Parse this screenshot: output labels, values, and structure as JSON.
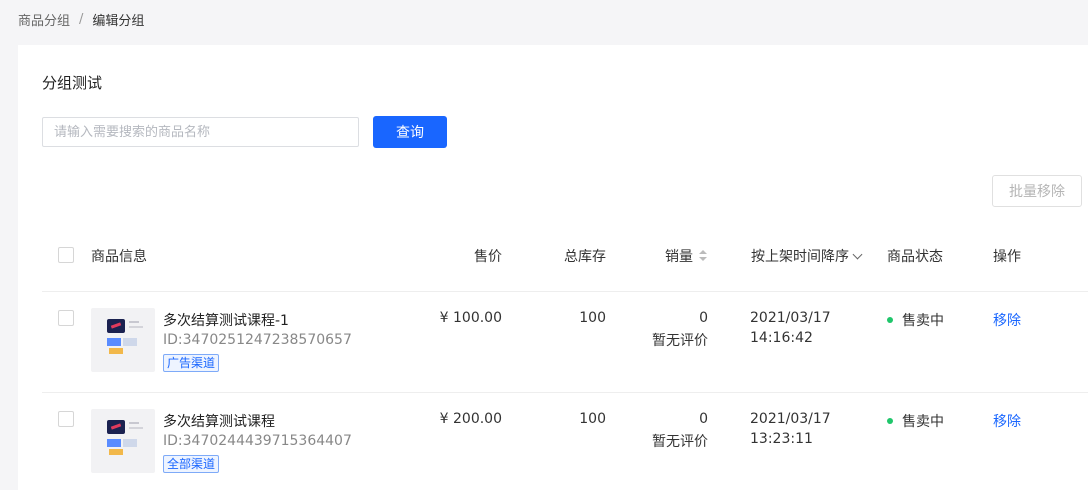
{
  "breadcrumb": {
    "parent": "商品分组",
    "separator": "/",
    "current": "编辑分组"
  },
  "group": {
    "title": "分组测试"
  },
  "search": {
    "placeholder": "请输入需要搜索的商品名称",
    "value": "",
    "button_label": "查询"
  },
  "toolbar": {
    "batch_remove_label": "批量移除"
  },
  "table": {
    "headers": {
      "info": "商品信息",
      "price": "售价",
      "stock": "总库存",
      "sales": "销量",
      "time_sort": "按上架时间降序",
      "status": "商品状态",
      "action": "操作"
    },
    "rows": [
      {
        "name": "多次结算测试课程-1",
        "id": "ID:3470251247238570657",
        "channel": "广告渠道",
        "price": "¥ 100.00",
        "stock": "100",
        "sales": "0",
        "rating": "暂无评价",
        "date": "2021/03/17",
        "time": "14:16:42",
        "status": "售卖中",
        "action": "移除"
      },
      {
        "name": "多次结算测试课程",
        "id": "ID:3470244439715364407",
        "channel": "全部渠道",
        "price": "¥ 200.00",
        "stock": "100",
        "sales": "0",
        "rating": "暂无评价",
        "date": "2021/03/17",
        "time": "13:23:11",
        "status": "售卖中",
        "action": "移除"
      }
    ]
  },
  "colors": {
    "accent": "#1966ff",
    "status_on_sale": "#1fc66b",
    "background": "#f5f5f7"
  }
}
